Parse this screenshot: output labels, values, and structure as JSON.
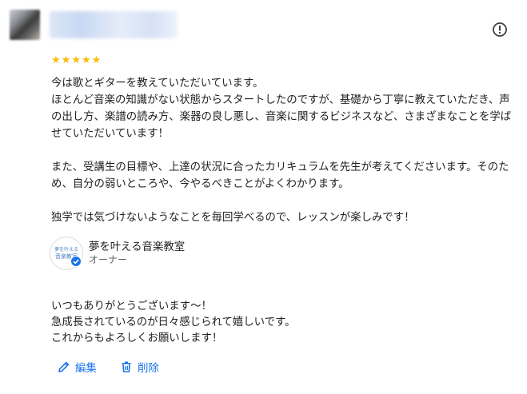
{
  "reviewer": {
    "avatar": "blurred-avatar",
    "name_blurred": true
  },
  "report_icon": "exclamation-circle-icon",
  "rating": {
    "value": 5,
    "max": 5,
    "color": "#fbbc04"
  },
  "review_text": "今は歌とギターを教えていただいています。\nほとんど音楽の知識がない状態からスタートしたのですが、基礎から丁寧に教えていただき、声の出し方、楽譜の読み方、楽器の良し悪し、音楽に関するビジネスなど、さまざまなことを学ばせていただいています！\n\nまた、受講生の目標や、上達の状況に合ったカリキュラムを先生が考えてくださいます。そのため、自分の弱いところや、今やるべきことがよくわかります。\n\n独学では気づけないようなことを毎回学べるので、レッスンが楽しみです！",
  "owner": {
    "logo_text_1": "夢を叶える",
    "logo_text_2": "音楽教室",
    "name": "夢を叶える音楽教室",
    "role": "オーナー",
    "verified_icon": "verified-badge-icon"
  },
  "reply_text": "いつもありがとうございます～！\n急成長されているのが日々感じられて嬉しいです。\nこれからもよろしくお願いします！",
  "actions": {
    "edit_label": "編集",
    "delete_label": "削除",
    "accent": "#1a73e8"
  }
}
